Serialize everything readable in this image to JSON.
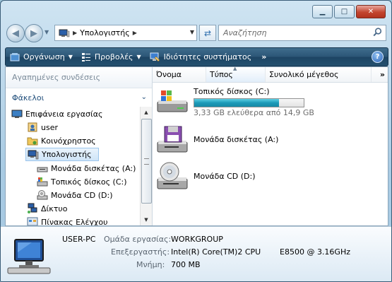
{
  "window": {
    "caption": {
      "minimize": "▁",
      "maximize": "□",
      "close": "✕"
    }
  },
  "address_bar": {
    "path": "Υπολογιστής",
    "search_placeholder": "Αναζήτηση"
  },
  "toolbar": {
    "organize": "Οργάνωση",
    "views": "Προβολές",
    "system_properties": "Ιδιότητες συστήματος",
    "more": "»",
    "help": "?"
  },
  "nav_pane": {
    "favorites_header": "Αγαπημένες συνδέσεις",
    "folders_header": "Φάκελοι",
    "tree": [
      {
        "label": "Επιφάνεια εργασίας",
        "icon": "desktop-icon"
      },
      {
        "label": "user",
        "icon": "user-folder-icon"
      },
      {
        "label": "Κοινόχρηστος",
        "icon": "folder-icon"
      },
      {
        "label": "Υπολογιστής",
        "icon": "computer-icon",
        "selected": true
      },
      {
        "label": "Μονάδα δισκέτας (A:)",
        "icon": "floppy-drive-icon"
      },
      {
        "label": "Τοπικός δίσκος (C:)",
        "icon": "hard-drive-icon"
      },
      {
        "label": "Μονάδα CD (D:)",
        "icon": "cd-drive-icon"
      },
      {
        "label": "Δίκτυο",
        "icon": "network-icon"
      },
      {
        "label": "Πίνακας Ελέγχου",
        "icon": "control-panel-icon"
      }
    ]
  },
  "columns": {
    "name": "Όνομα",
    "type": "Τύπος",
    "total_size": "Συνολικό μέγεθος",
    "more": "»"
  },
  "drives": [
    {
      "name": "Τοπικός δίσκος (C:)",
      "icon": "hard-drive-icon",
      "free_text": "3,33 GB ελεύθερα από 14,9 GB",
      "used_fraction": 0.777
    },
    {
      "name": "Μονάδα δισκέτας (A:)",
      "icon": "floppy-drive-icon"
    },
    {
      "name": "Μονάδα CD (D:)",
      "icon": "cd-drive-icon"
    }
  ],
  "details": {
    "computer_name": "USER-PC",
    "workgroup_label": "Ομάδα εργασίας:",
    "workgroup_value": "WORKGROUP",
    "processor_label": "Επεξεργαστής:",
    "processor_value": "Intel(R) Core(TM)2 CPU",
    "processor_model": "E8500  @ 3.16GHz",
    "memory_label": "Μνήμη:",
    "memory_value": "700 MB"
  },
  "colors": {
    "toolbar": "#24506f",
    "capacity_fill": "#1c9ab8",
    "selection": "#cfe5f8"
  }
}
